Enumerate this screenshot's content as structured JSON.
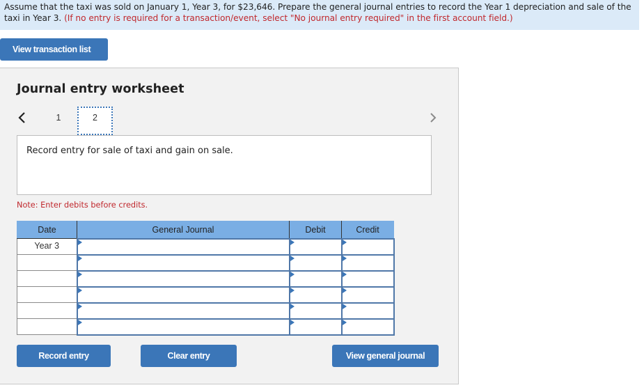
{
  "instructions": {
    "text": "Assume that the taxi was sold on January 1, Year 3, for $23,646. Prepare the general journal entries to record the Year 1 depreciation and sale of the taxi in Year 3.",
    "note": "(If no entry is required for a transaction/event, select \"No journal entry required\" in the first account field.)"
  },
  "buttons": {
    "view_transaction_list": "View transaction list",
    "record_entry": "Record entry",
    "clear_entry": "Clear entry",
    "view_general_journal": "View general journal"
  },
  "worksheet": {
    "title": "Journal entry worksheet",
    "pages": [
      "1",
      "2"
    ],
    "current_page": "2",
    "description": "Record entry for sale of taxi and gain on sale.",
    "note": "Note: Enter debits before credits."
  },
  "table": {
    "headers": [
      "Date",
      "General Journal",
      "Debit",
      "Credit"
    ],
    "rows": [
      {
        "date": "Year 3",
        "account": "",
        "debit": "",
        "credit": ""
      },
      {
        "date": "",
        "account": "",
        "debit": "",
        "credit": ""
      },
      {
        "date": "",
        "account": "",
        "debit": "",
        "credit": ""
      },
      {
        "date": "",
        "account": "",
        "debit": "",
        "credit": ""
      },
      {
        "date": "",
        "account": "",
        "debit": "",
        "credit": ""
      },
      {
        "date": "",
        "account": "",
        "debit": "",
        "credit": ""
      }
    ]
  },
  "colors": {
    "accent": "#3b76b8",
    "header": "#7aaee4",
    "warning": "#c0282d",
    "instructions_bg": "#dbeaf8"
  }
}
